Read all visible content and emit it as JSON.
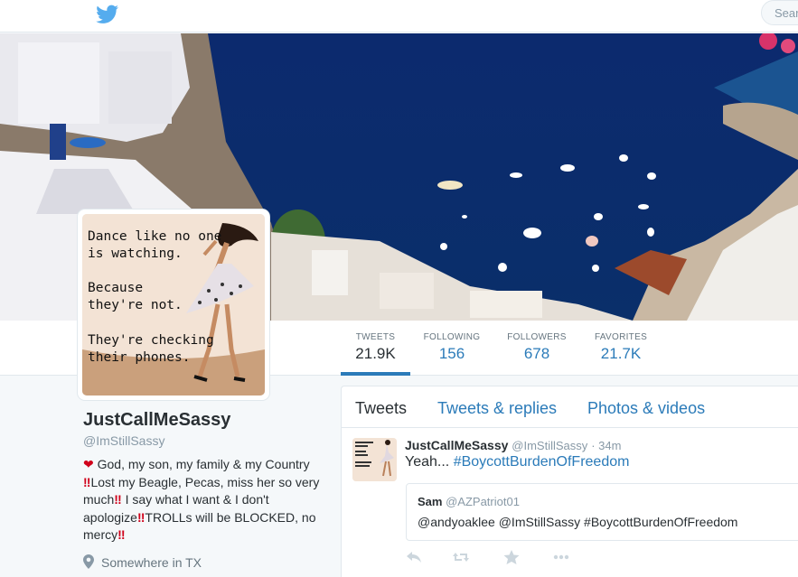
{
  "topbar": {
    "logo_icon": "twitter-bird-icon",
    "search_placeholder": "Sear"
  },
  "colors": {
    "brand": "#55acee",
    "link": "#2b7bb9",
    "muted": "#8899a6",
    "alert": "#d0021b"
  },
  "avatar": {
    "lines1": "Dance like no one\nis watching.",
    "lines2": "Because\nthey're not.",
    "lines3": "They're checking\ntheir phones."
  },
  "stats": [
    {
      "label": "TWEETS",
      "value": "21.9K"
    },
    {
      "label": "FOLLOWING",
      "value": "156"
    },
    {
      "label": "FOLLOWERS",
      "value": "678"
    },
    {
      "label": "FAVORITES",
      "value": "21.7K"
    }
  ],
  "profile": {
    "name": "JustCallMeSassy",
    "handle": "@ImStillSassy",
    "bio": {
      "heart": "❤",
      "p1": " God, my son, my family & my Country",
      "bang1": "‼",
      "p2": "Lost my Beagle, Pecas, miss her so very much",
      "bang2": "‼",
      "p3": " I say what I want & I don't apologize",
      "bang3": "‼",
      "p4": "TROLLs will be BLOCKED, no mercy",
      "bang4": "‼"
    },
    "location": "Somewhere in TX"
  },
  "tabs": [
    {
      "label": "Tweets"
    },
    {
      "label": "Tweets & replies"
    },
    {
      "label": "Photos & videos"
    }
  ],
  "tweet": {
    "name": "JustCallMeSassy",
    "handle": "@ImStillSassy",
    "time": "· 34m",
    "text_prefix": "Yeah... ",
    "hashtag": "#BoycottBurdenOfFreedom",
    "quote": {
      "name": "Sam",
      "handle": "@AZPatriot01",
      "text": "@andyoaklee @ImStillSassy #BoycottBurdenOfFreedom"
    },
    "action_icons": [
      "reply-icon",
      "retweet-icon",
      "favorite-icon",
      "more-icon"
    ]
  }
}
